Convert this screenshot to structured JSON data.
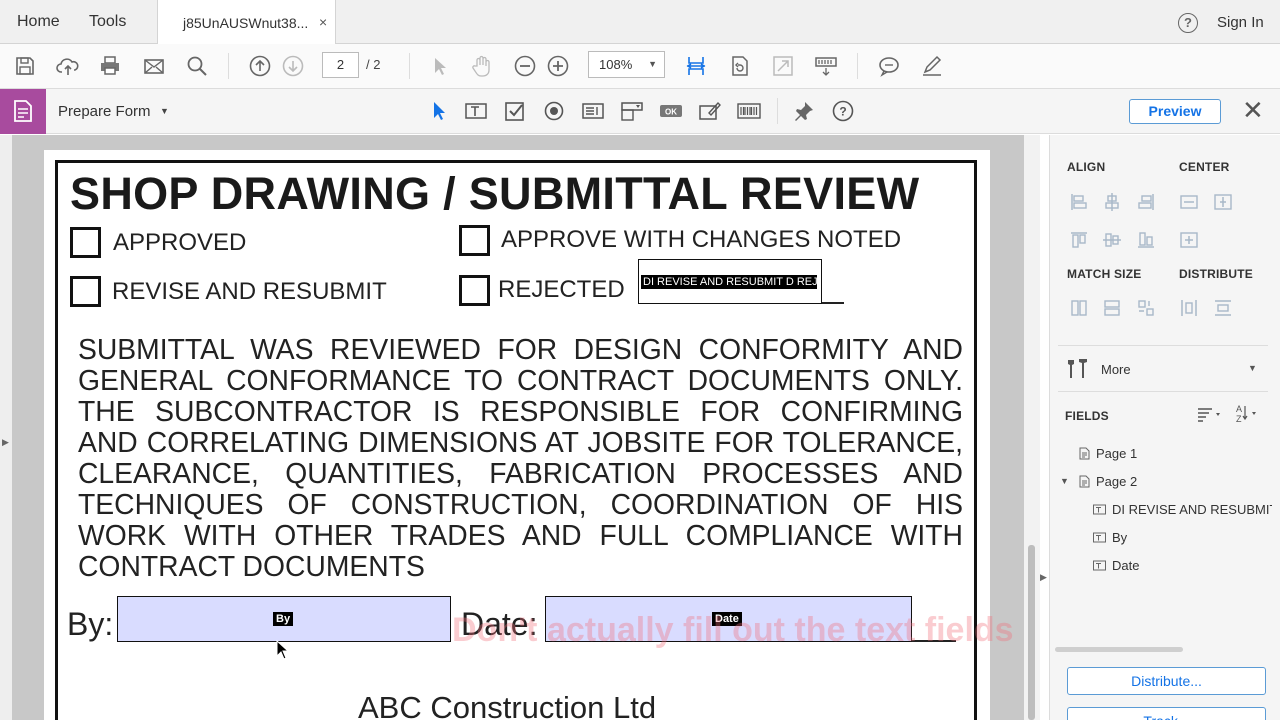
{
  "top_nav": {
    "home": "Home",
    "tools": "Tools",
    "doc_tab_title": "j85UnAUSWnut38...",
    "doc_tab_close": "×",
    "help": "?",
    "sign_in": "Sign In"
  },
  "toolbar": {
    "page_current": "2",
    "page_total": "/ 2",
    "zoom": "108%"
  },
  "form_bar": {
    "label": "Prepare Form",
    "preview": "Preview",
    "close": "✕"
  },
  "document": {
    "title": "SHOP DRAWING / SUBMITTAL REVIEW",
    "checkboxes": {
      "approved": "APPROVED",
      "approve_with_changes": "APPROVE WITH CHANGES NOTED",
      "revise_resubmit": "REVISE AND RESUBMIT",
      "rejected": "REJECTED"
    },
    "selected_field_tag": "DI REVISE AND RESUBMIT D REJECTED",
    "paragraph": "SUBMITTAL WAS REVIEWED FOR DESIGN CONFORMITY AND GENERAL CONFORMANCE TO CONTRACT DOCUMENTS ONLY. THE SUBCONTRACTOR IS RESPONSIBLE FOR CONFIRMING AND CORRELATING DIMENSIONS AT JOBSITE FOR TOLERANCE, CLEARANCE, QUANTITIES, FABRICATION PROCESSES AND TECHNIQUES OF CONSTRUCTION, COORDINATION OF HIS WORK WITH OTHER TRADES AND FULL COMPLIANCE WITH CONTRACT DOCUMENTS",
    "by_label": "By:",
    "by_field_tag": "By",
    "date_label": "Date:",
    "date_field_tag": "Date",
    "company": "ABC Construction Ltd"
  },
  "overlay_caption": "Don't actually fill out the text fields",
  "right_panel": {
    "align": "ALIGN",
    "center": "CENTER",
    "match_size": "MATCH SIZE",
    "distribute": "DISTRIBUTE",
    "more": "More",
    "fields": "FIELDS",
    "tree": {
      "page1": "Page 1",
      "page2": "Page 2",
      "field1": "DI REVISE AND RESUBMIT",
      "field2": "By",
      "field3": "Date"
    },
    "distribute_button": "Distribute...",
    "track_button": "Track..."
  },
  "colors": {
    "accent_purple": "#a84b9e",
    "field_fill": "#d9dcff",
    "link_blue": "#1473e6",
    "watermark": "#f06e78"
  }
}
